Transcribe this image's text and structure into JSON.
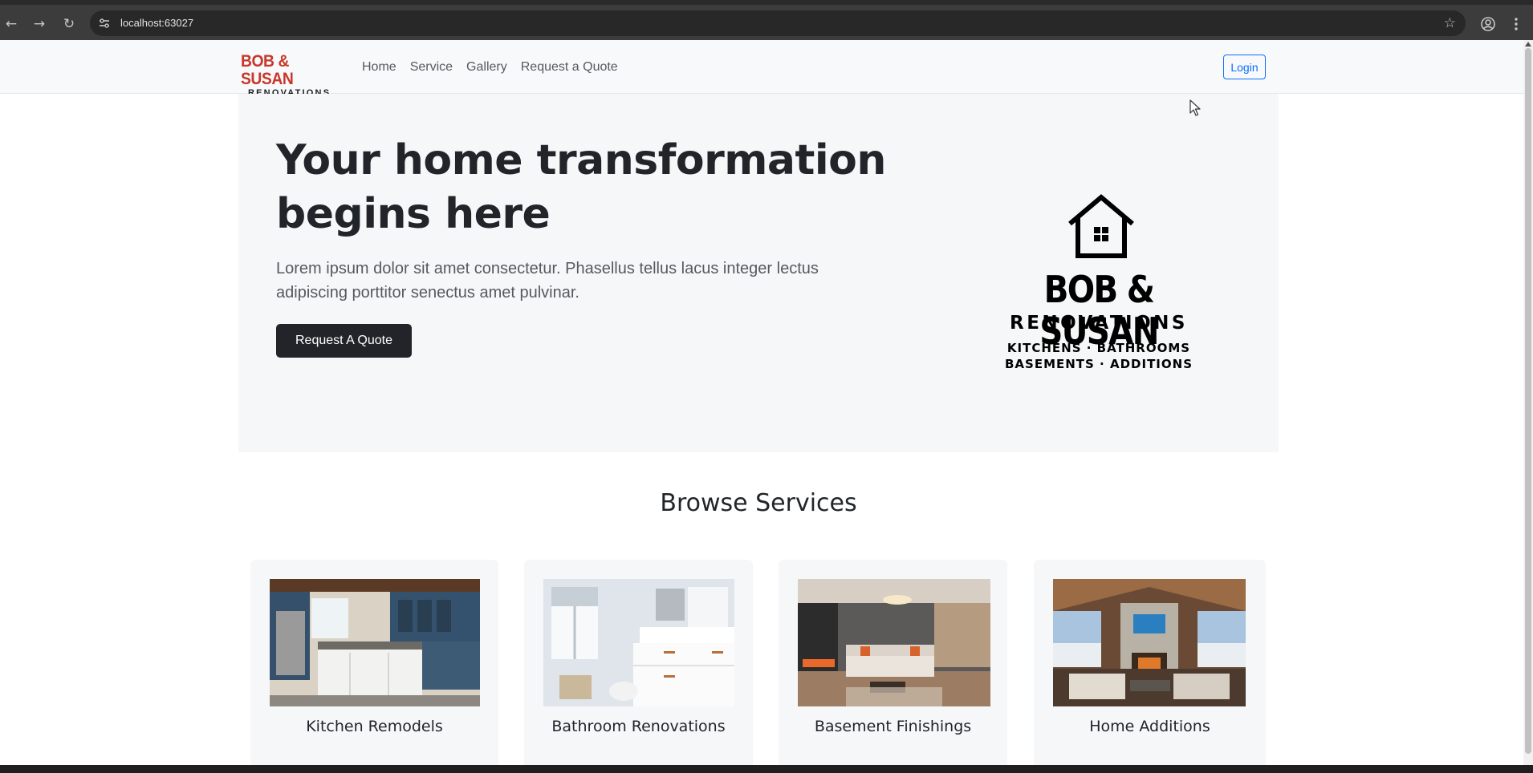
{
  "browser": {
    "url": "localhost:63027"
  },
  "navbar": {
    "brand_line1": "BOB & SUSAN",
    "brand_line2": "RENOVATIONS",
    "links": [
      "Home",
      "Service",
      "Gallery",
      "Request a Quote"
    ],
    "login_label": "Login"
  },
  "hero": {
    "title": "Your home transformation begins here",
    "text": "Lorem ipsum dolor sit amet consectetur. Phasellus tellus lacus integer lectus adipiscing porttitor senectus amet pulvinar.",
    "button_label": "Request A Quote",
    "logo": {
      "name": "BOB & SUSAN",
      "sub": "RENOVATIONS",
      "tag_line1": "KITCHENS · BATHROOMS",
      "tag_line2": "BASEMENTS · ADDITIONS"
    }
  },
  "services": {
    "title": "Browse Services",
    "items": [
      {
        "label": "Kitchen Remodels"
      },
      {
        "label": "Bathroom Renovations"
      },
      {
        "label": "Basement Finishings"
      },
      {
        "label": "Home Additions"
      }
    ]
  },
  "colors": {
    "brand_red": "#c8372a",
    "primary_dark": "#212529",
    "login_blue": "#0d6efd",
    "hero_bg": "#f6f7f8"
  }
}
